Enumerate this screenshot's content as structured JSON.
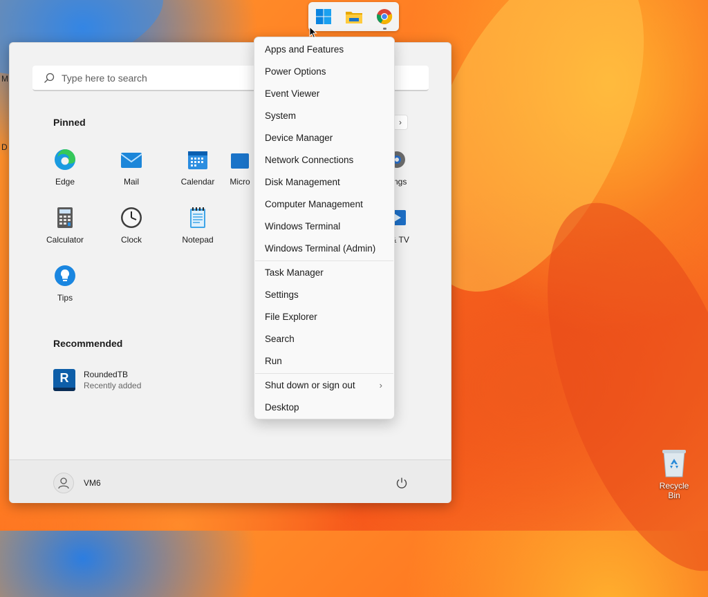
{
  "taskbar": {
    "icons": [
      "windows-start-icon",
      "file-explorer-icon",
      "chrome-icon"
    ]
  },
  "start_menu": {
    "search_placeholder": "Type here to search",
    "pinned_title": "Pinned",
    "pinned_next_glyph": "›",
    "pinned_apps": [
      {
        "label": "Edge",
        "icon": "edge-icon"
      },
      {
        "label": "Mail",
        "icon": "mail-icon"
      },
      {
        "label": "Calendar",
        "icon": "calendar-icon"
      },
      {
        "label": "Micro",
        "icon": "store-icon"
      },
      {
        "label": "ttings",
        "icon": "settings-icon"
      },
      {
        "label": "Calculator",
        "icon": "calculator-icon"
      },
      {
        "label": "Clock",
        "icon": "clock-icon"
      },
      {
        "label": "Notepad",
        "icon": "notepad-icon"
      },
      {
        "label": "s & TV",
        "icon": "movies-tv-icon"
      },
      {
        "label": "Tips",
        "icon": "tips-icon"
      }
    ],
    "recommended_title": "Recommended",
    "recommended": [
      {
        "name": "RoundedTB",
        "subtitle": "Recently added",
        "icon_letter": "R"
      }
    ],
    "user_name": "VM6"
  },
  "context_menu": {
    "items": [
      {
        "label": "Apps and Features"
      },
      {
        "label": "Power Options"
      },
      {
        "label": "Event Viewer"
      },
      {
        "label": "System"
      },
      {
        "label": "Device Manager"
      },
      {
        "label": "Network Connections"
      },
      {
        "label": "Disk Management"
      },
      {
        "label": "Computer Management"
      },
      {
        "label": "Windows Terminal"
      },
      {
        "label": "Windows Terminal (Admin)"
      },
      {
        "label": "Task Manager"
      },
      {
        "label": "Settings"
      },
      {
        "label": "File Explorer"
      },
      {
        "label": "Search"
      },
      {
        "label": "Run"
      },
      {
        "label": "Shut down or sign out",
        "chevron": "›"
      },
      {
        "label": "Desktop"
      }
    ]
  },
  "desktop": {
    "recycle_bin_label": "Recycle Bin",
    "edge_labels": [
      "M",
      "D"
    ]
  },
  "colors": {
    "accent_blue": "#0078d4",
    "menu_bg": "#f9f9f9",
    "start_bg": "#f2f2f2",
    "wallpaper_orange": "#ff7a22"
  }
}
